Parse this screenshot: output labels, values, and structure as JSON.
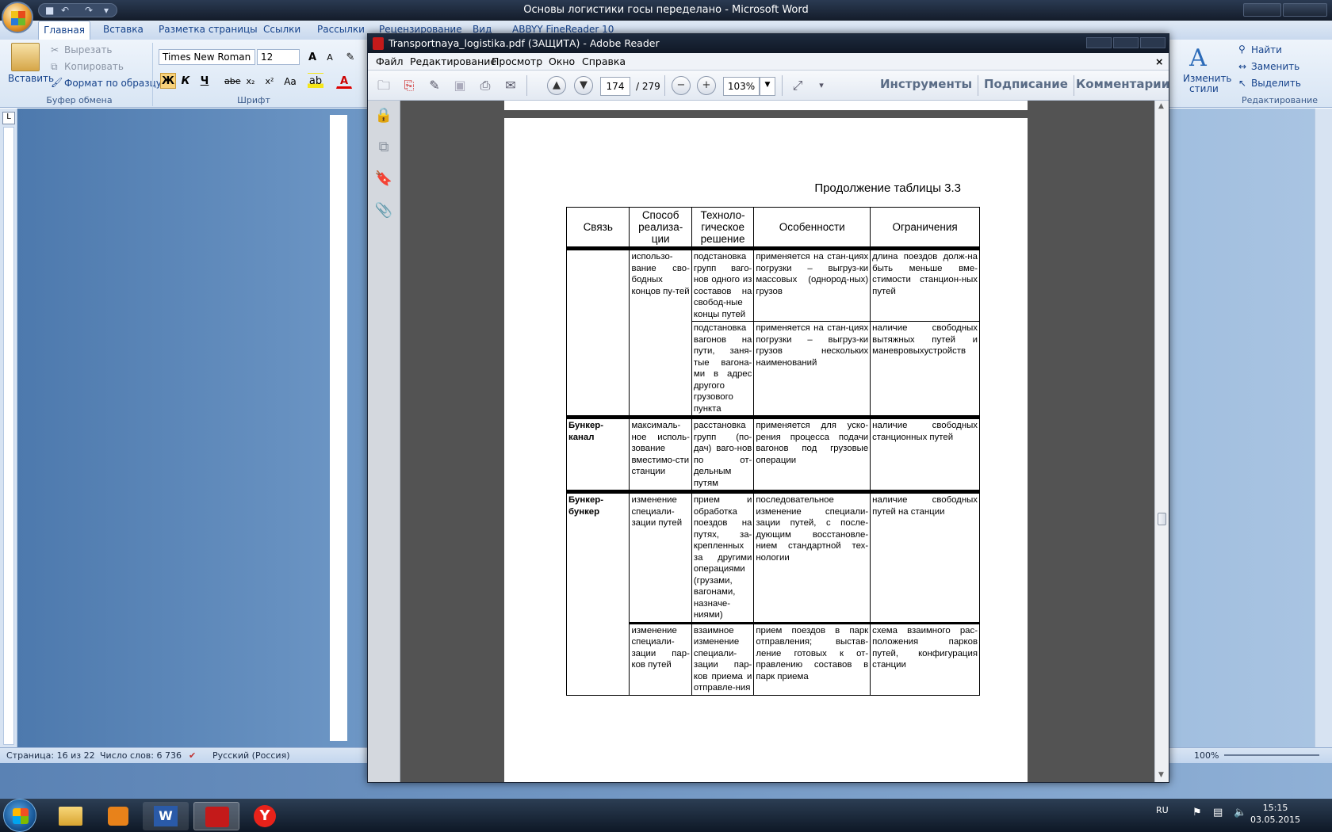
{
  "word": {
    "title": "Основы логистики госы переделано - Microsoft Word",
    "tabs": [
      "Главная",
      "Вставка",
      "Разметка страницы",
      "Ссылки",
      "Рассылки",
      "Рецензирование",
      "Вид",
      "ABBYY FineReader 10"
    ],
    "clipboard": {
      "paste": "Вставить",
      "cut": "Вырезать",
      "copy": "Копировать",
      "format_painter": "Формат по образцу",
      "group": "Буфер обмена"
    },
    "font": {
      "name": "Times New Roman",
      "size": "12",
      "bold": "Ж",
      "italic": "К",
      "underline": "Ч",
      "strike": "abe",
      "sub": "x₂",
      "sup": "x²",
      "case": "Aa",
      "grow": "A",
      "shrink": "A",
      "color_a": "A",
      "group": "Шрифт"
    },
    "editing": {
      "find": "Найти",
      "replace": "Заменить",
      "select": "Выделить",
      "change_styles_1": "Изменить",
      "change_styles_2": "стили",
      "group": "Редактирование"
    },
    "status": {
      "page": "Страница: 16 из 22",
      "words": "Число слов: 6 736",
      "language": "Русский (Россия)",
      "zoom": "100%"
    }
  },
  "reader": {
    "title": "Transportnaya_logistika.pdf (ЗАЩИТА) - Adobe Reader",
    "menu": [
      "Файл",
      "Редактирование",
      "Просмотр",
      "Окно",
      "Справка"
    ],
    "page_current": "174",
    "page_total": "/ 279",
    "zoom": "103%",
    "tools": "Инструменты",
    "sign": "Подписание",
    "comments": "Комментарии"
  },
  "document": {
    "caption": "Продолжение таблицы 3.3",
    "headers": [
      "Связь",
      "Способ реализа-ции",
      "Техноло-гическое решение",
      "Особенности",
      "Ограничения"
    ],
    "rows": [
      {
        "link": "",
        "method": "использо-вание сво-бодных концов пу-тей",
        "solution": "подстановка групп ваго-нов одного из составов на свобод-ные концы путей",
        "features": "применяется на стан-циях погрузки – выгруз-ки массовых (однород-ных) грузов",
        "limits": "длина поездов долж-на быть меньше вме-стимости станцион-ных путей"
      },
      {
        "solution": "подстановка вагонов на пути, заня-тые вагона-ми в адрес другого грузового пункта",
        "features": "применяется на стан-циях погрузки – выгруз-ки грузов нескольких наименований",
        "limits": "наличие свободных вытяжных путей и маневровыхустройств"
      },
      {
        "link": "Бункер-канал",
        "method": "максималь-ное исполь-зование вместимо-сти станции",
        "solution": "расстановка групп (по-дач) ваго-нов по от-дельным путям",
        "features": "применяется для уско-рения процесса подачи вагонов под грузовые операции",
        "limits": "наличие свободных станционных путей"
      },
      {
        "link": "Бункер-бункер",
        "method": "изменение специали-зации путей",
        "solution": "прием и обработка поездов на путях, за-крепленных за другими операциями (грузами, вагонами, назначе-ниями)",
        "features": "последовательное изменение специали-зации путей, с после-дующим восстановле-нием стандартной тех-нологии",
        "limits": "наличие свободных путей на станции"
      },
      {
        "method": "изменение специали-зации пар-ков путей",
        "solution": "взаимное изменение специали-зации пар-ков приема и отправле-ния",
        "features": "прием поездов в парк отправления; выстав-ление готовых к от-правлению составов в парк приема",
        "limits": "схема взаимного рас-положения парков путей, конфигурация станции"
      }
    ]
  },
  "taskbar": {
    "language": "RU",
    "time": "15:15",
    "date": "03.05.2015"
  }
}
